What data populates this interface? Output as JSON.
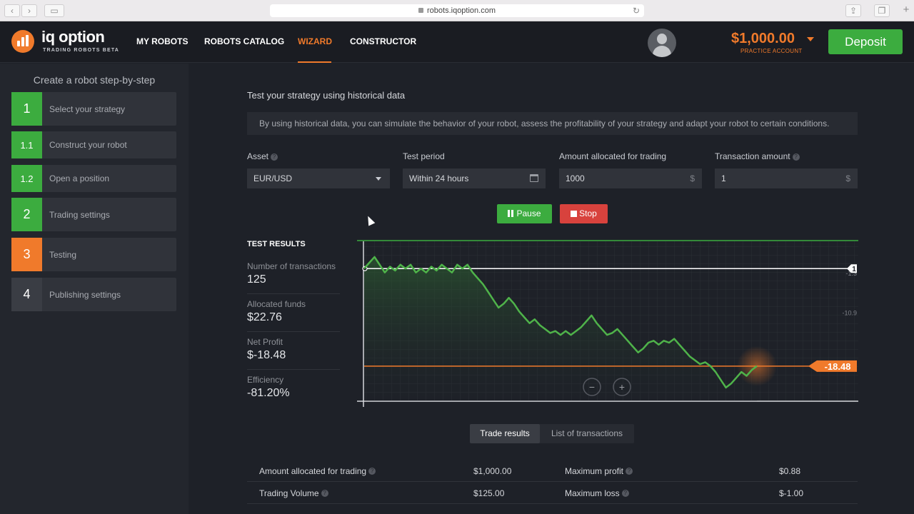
{
  "browser": {
    "url": "robots.iqoption.com"
  },
  "header": {
    "logo_text": "iq option",
    "logo_sub": "TRADING ROBOTS BETA",
    "nav": [
      "MY ROBOTS",
      "ROBOTS CATALOG",
      "WIZARD",
      "CONSTRUCTOR"
    ],
    "active_nav": "WIZARD",
    "balance": "$1,000.00",
    "balance_sub": "PRACTICE ACCOUNT",
    "deposit_label": "Deposit",
    "accent": "#f07a2b",
    "success": "#3cac3f"
  },
  "sidebar": {
    "title": "Create a robot step-by-step",
    "steps": [
      {
        "num": "1",
        "label": "Select your strategy",
        "state": "done"
      },
      {
        "num": "1.1",
        "label": "Construct your robot",
        "state": "done"
      },
      {
        "num": "1.2",
        "label": "Open a position",
        "state": "done"
      },
      {
        "num": "2",
        "label": "Trading settings",
        "state": "done"
      },
      {
        "num": "3",
        "label": "Testing",
        "state": "current"
      },
      {
        "num": "4",
        "label": "Publishing settings",
        "state": "pending"
      }
    ]
  },
  "main": {
    "title": "Test your strategy using historical data",
    "info": "By using historical data, you can simulate the behavior of your robot, assess the profitability of your strategy and adapt your robot to certain conditions.",
    "fields": {
      "asset_label": "Asset",
      "asset_value": "EUR/USD",
      "period_label": "Test period",
      "period_value": "Within 24 hours",
      "amount_label": "Amount allocated for trading",
      "amount_value": "1000",
      "amount_suffix": "$",
      "tx_label": "Transaction amount",
      "tx_value": "1",
      "tx_suffix": "$",
      "help_glyph": "?"
    },
    "pause_label": "Pause",
    "stop_label": "Stop"
  },
  "results": {
    "title": "TEST RESULTS",
    "items": [
      {
        "label": "Number of transactions",
        "value": "125"
      },
      {
        "label": "Allocated funds",
        "value": "$22.76"
      },
      {
        "label": "Net Profit",
        "value": "$-18.48"
      },
      {
        "label": "Efficiency",
        "value": "-81.20%"
      }
    ]
  },
  "chart_data": {
    "type": "line",
    "title": "",
    "xlabel": "",
    "ylabel": "",
    "y_tick_labels": [
      "-1.3",
      "-10.9"
    ],
    "baseline_marker": "1",
    "current_value_label": "-18.48",
    "zoom_out": "−",
    "zoom_in": "+",
    "series": [
      {
        "values": [
          1,
          2.5,
          4,
          2,
          0,
          1.5,
          0.5,
          2,
          1,
          2,
          0,
          1,
          0,
          1.5,
          0.5,
          2,
          1,
          0,
          2,
          1,
          2,
          0,
          -1.5,
          -3,
          -5,
          -7,
          -9,
          -8,
          -6.5,
          -8,
          -10,
          -11.5,
          -13,
          -12,
          -13.5,
          -14.5,
          -15.5,
          -15,
          -16,
          -15,
          -16,
          -15,
          -14,
          -12.5,
          -11,
          -13,
          -14.5,
          -16,
          -15.5,
          -14.5,
          -16,
          -17.5,
          -19,
          -20.5,
          -19.5,
          -18,
          -17.5,
          -18.5,
          -17.5,
          -18,
          -17,
          -18.5,
          -20,
          -21.5,
          -22.5,
          -23.5,
          -23,
          -24,
          -25.5,
          -27.5,
          -29.5,
          -28.5,
          -27,
          -25.5,
          -26.5,
          -25,
          -24
        ]
      }
    ],
    "colors": {
      "line": "#4fb34a",
      "baseline": "#ffffff",
      "current": "#f07a2b"
    }
  },
  "tabs": {
    "active": "Trade results",
    "inactive": "List of transactions"
  },
  "trade_rows": [
    {
      "l1": "Amount allocated for trading",
      "v1": "$1,000.00",
      "l2": "Maximum profit",
      "v2": "$0.88"
    },
    {
      "l1": "Trading Volume",
      "v1": "$125.00",
      "l2": "Maximum loss",
      "v2": "$-1.00"
    }
  ]
}
